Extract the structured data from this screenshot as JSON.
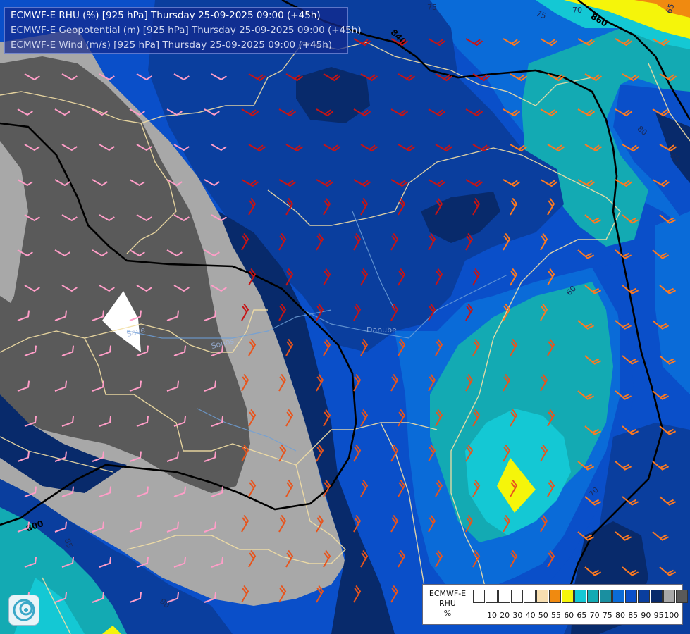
{
  "header": {
    "line1": "ECMWF-E RHU (%) [925 hPa] Thursday 25-09-2025 09:00 (+45h)",
    "line2": "ECMWF-E Geopotential (m) [925 hPa] Thursday 25-09-2025 09:00 (+45h)",
    "line3": "ECMWF-E Wind (m/s) [925 hPa] Thursday 25-09-2025 09:00 (+45h)"
  },
  "map_labels": {
    "isobars": [
      "840",
      "860",
      "800",
      "80",
      "85",
      "75",
      "75",
      "70",
      "65",
      "60",
      "75",
      "80",
      "85",
      "80",
      "75",
      "90",
      "70"
    ],
    "rivers": [
      "Danube",
      "Save",
      "Sonos"
    ]
  },
  "legend": {
    "title_line1": "ECMWF-E",
    "title_line2": "RHU",
    "title_line3": "%",
    "colors": [
      "#ffffff",
      "#ffffff",
      "#ffffff",
      "#ffffff",
      "#ffffff",
      "#f7deb0",
      "#f08a10",
      "#f5f50a",
      "#14c8d4",
      "#13aab3",
      "#1a8fa0",
      "#0a6bd8",
      "#0a4fc9",
      "#0a3e9e",
      "#082a6b",
      "#a8a8a8",
      "#5a5a5a"
    ],
    "ticks": [
      "10",
      "20",
      "30",
      "40",
      "50",
      "55",
      "60",
      "65",
      "70",
      "75",
      "80",
      "85",
      "90",
      "95",
      "100"
    ]
  },
  "colors": {
    "rh_95_100": "#5a5a5a",
    "rh_90_95": "#a8a8a8",
    "rh_85_90": "#082a6b",
    "rh_80_85": "#0a3e9e",
    "rh_75_80": "#0a4fc9",
    "rh_70_75": "#0a6bd8",
    "rh_65_70": "#13aab3",
    "rh_60_65": "#14c8d4",
    "rh_low": "#f5f50a",
    "border": "#f3dfa5",
    "river": "#6fa0d8"
  }
}
